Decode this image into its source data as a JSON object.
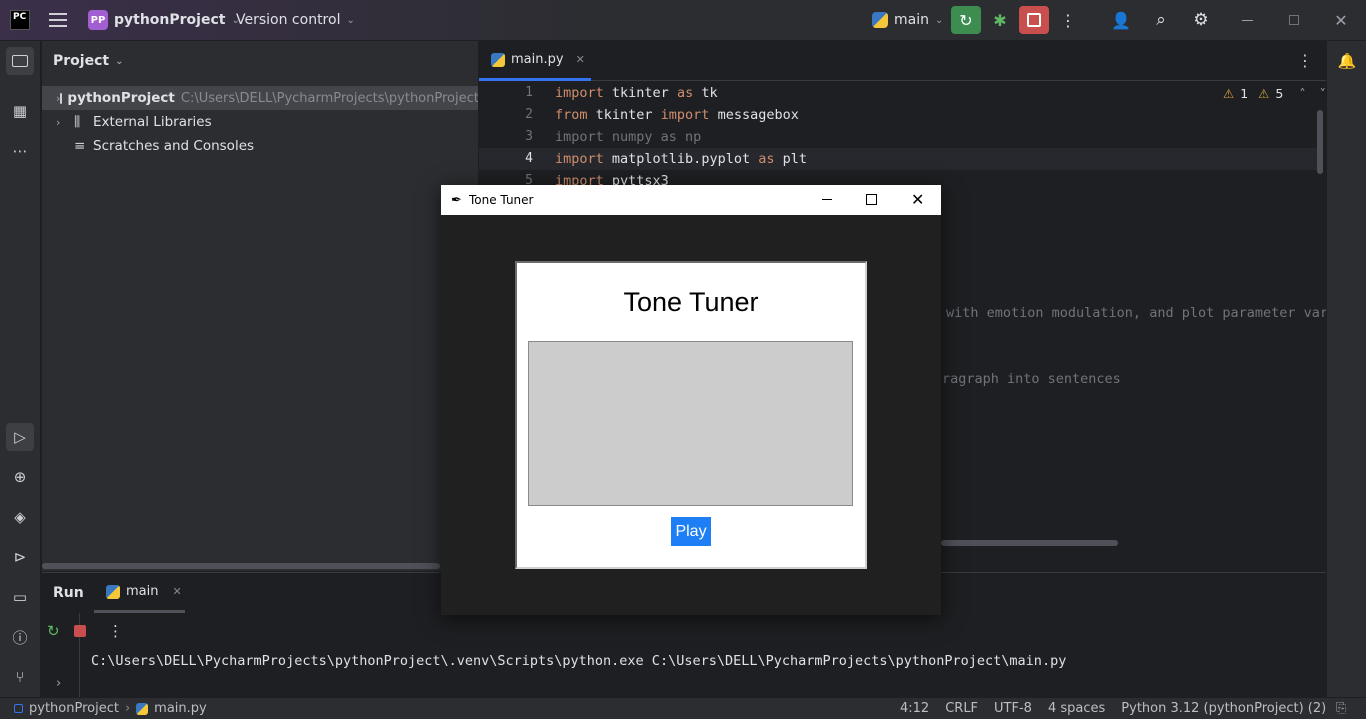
{
  "titlebar": {
    "app_logo": "PC",
    "project_badge": "PP",
    "project_name": "pythonProject",
    "version_control": "Version control",
    "branch": "main"
  },
  "project_panel": {
    "title": "Project",
    "items": [
      {
        "label": "pythonProject",
        "path": "C:\\Users\\DELL\\PycharmProjects\\pythonProject"
      },
      {
        "label": "External Libraries"
      },
      {
        "label": "Scratches and Consoles"
      }
    ]
  },
  "editor": {
    "tab": "main.py",
    "inspections": {
      "warnings": "1",
      "weak_warnings": "5"
    },
    "lines": [
      "1",
      "2",
      "3",
      "4",
      "5"
    ],
    "code": {
      "l1_kw": "import",
      "l1_rest": " tkinter ",
      "l1_as": "as",
      "l1_end": " tk",
      "l2_kw": "from",
      "l2_rest": " tkinter ",
      "l2_imp": "import",
      "l2_end": " messagebox",
      "l3": "import numpy as np",
      "l4_kw": "import",
      "l4_rest": " matplotlib.pyplot ",
      "l4_as": "as",
      "l4_end": " plt",
      "l5_kw": "import",
      "l5_rest": " pyttsx3"
    },
    "partial_line_1": "with emotion modulation, and plot parameter vari",
    "partial_line_2": "ragraph into sentences"
  },
  "run_panel": {
    "tab_run": "Run",
    "tab_main": "main",
    "output": "C:\\Users\\DELL\\PycharmProjects\\pythonProject\\.venv\\Scripts\\python.exe C:\\Users\\DELL\\PycharmProjects\\pythonProject\\main.py"
  },
  "statusbar": {
    "breadcrumb_project": "pythonProject",
    "breadcrumb_file": "main.py",
    "position": "4:12",
    "line_sep": "CRLF",
    "encoding": "UTF-8",
    "indent": "4 spaces",
    "interpreter": "Python 3.12 (pythonProject) (2)"
  },
  "tk_window": {
    "title": "Tone Tuner",
    "heading": "Tone Tuner",
    "button": "Play"
  },
  "colors": {
    "accent_blue": "#1e7ef5",
    "run_green": "#3e8d50",
    "stop_red": "#c94f4f",
    "keyword": "#cf8e6d"
  }
}
